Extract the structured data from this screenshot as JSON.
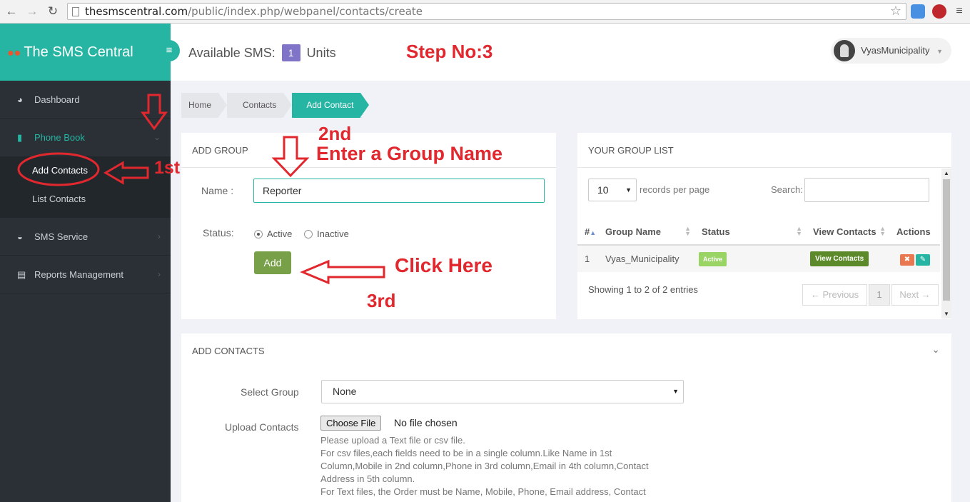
{
  "browser": {
    "url_host": "thesmscentral.com",
    "url_path": "/public/index.php/webpanel/contacts/create"
  },
  "sidebar": {
    "brand": "The SMS Central",
    "items": [
      {
        "label": "Dashboard",
        "icon": "dashboard-icon"
      },
      {
        "label": "Phone Book",
        "icon": "book-icon"
      },
      {
        "label": "SMS Service",
        "icon": "comments-icon"
      },
      {
        "label": "Reports Management",
        "icon": "list-icon"
      }
    ],
    "submenu": [
      "Add Contacts",
      "List Contacts"
    ]
  },
  "header": {
    "available_label": "Available SMS:",
    "available_count": "1",
    "units_label": "Units",
    "step_note": "Step No:3",
    "username": "VyasMunicipality"
  },
  "breadcrumb": [
    "Home",
    "Contacts",
    "Add Contact"
  ],
  "add_group": {
    "title": "ADD GROUP",
    "name_label": "Name :",
    "name_value": "Reporter",
    "status_label": "Status:",
    "status_options": [
      "Active",
      "Inactive"
    ],
    "status_selected": "Active",
    "add_button": "Add"
  },
  "group_list": {
    "title": "YOUR GROUP LIST",
    "per_page_value": "10",
    "per_page_label": "records per page",
    "search_label": "Search:",
    "columns": [
      "#",
      "Group Name",
      "Status",
      "View Contacts",
      "Actions"
    ],
    "rows": [
      {
        "num": "1",
        "name": "Vyas_Municipality",
        "status": "Active",
        "view": "View Contacts"
      }
    ],
    "showing": "Showing 1 to 2 of 2 entries",
    "prev": "← Previous",
    "page": "1",
    "next": "Next →"
  },
  "add_contacts": {
    "title": "ADD CONTACTS",
    "select_group_label": "Select Group",
    "select_group_value": "None",
    "upload_label": "Upload Contacts",
    "file_button": "Choose File",
    "file_status": "No file chosen",
    "help_lines": [
      "Please upload a Text file or csv file.",
      "For csv files,each fields need to be in a single column.Like Name in 1st",
      "Column,Mobile in 2nd column,Phone in 3rd column,Email in 4th column,Contact",
      "Address in 5th column.",
      "For Text files, the Order must be Name, Mobile, Phone, Email address, Contact"
    ]
  },
  "annotations": {
    "first": "1st",
    "second": "2nd",
    "enter_group": "Enter a Group Name",
    "click_here": "Click Here",
    "third": "3rd"
  },
  "colors": {
    "accent": "#26b5a3",
    "sidebar": "#2a3036",
    "annotation": "#e0282e",
    "add_button": "#78a048"
  }
}
